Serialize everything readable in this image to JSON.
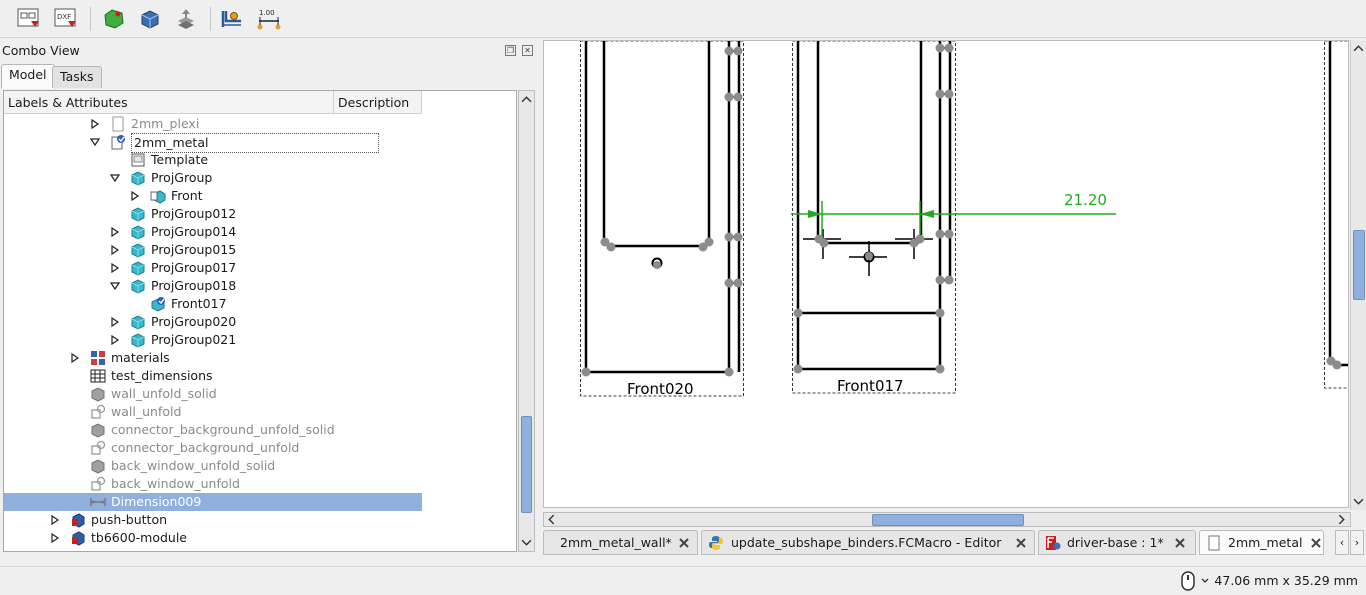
{
  "toolbar": {
    "buttons": [
      {
        "name": "export-page-svg",
        "icon": "export-svg-icon"
      },
      {
        "name": "export-page-dxf",
        "icon": "export-dxf-icon",
        "text": "DXF"
      },
      {
        "name": "draft-view",
        "icon": "draft-view-icon"
      },
      {
        "name": "arch-view",
        "icon": "arch-section-icon"
      },
      {
        "name": "spreadsheet-view",
        "icon": "spreadsheet-view-icon"
      },
      {
        "name": "insert-dimension",
        "icon": "dimension-icon"
      },
      {
        "name": "linear-dimension",
        "icon": "linear-dimension-icon",
        "text": "1.00"
      }
    ]
  },
  "combo": {
    "title": "Combo View",
    "tabs": [
      {
        "label": "Model",
        "active": true
      },
      {
        "label": "Tasks",
        "active": false
      }
    ]
  },
  "tree": {
    "columns": [
      "Labels & Attributes",
      "Description"
    ],
    "rows": [
      {
        "label": "2mm_plexi",
        "indent": 2,
        "expander": "collapsed",
        "icon": "page-icon",
        "muted": true
      },
      {
        "label": "2mm_metal",
        "indent": 2,
        "expander": "expanded",
        "icon": "page-check-icon",
        "editing": true
      },
      {
        "label": "Template",
        "indent": 3,
        "expander": "none",
        "icon": "template-icon"
      },
      {
        "label": "ProjGroup",
        "indent": 3,
        "expander": "expanded",
        "icon": "cube-icon"
      },
      {
        "label": "Front",
        "indent": 4,
        "expander": "collapsed",
        "icon": "projection-icon"
      },
      {
        "label": "ProjGroup012",
        "indent": 3,
        "expander": "none",
        "icon": "cube-icon"
      },
      {
        "label": "ProjGroup014",
        "indent": 3,
        "expander": "collapsed",
        "icon": "cube-icon"
      },
      {
        "label": "ProjGroup015",
        "indent": 3,
        "expander": "collapsed",
        "icon": "cube-icon"
      },
      {
        "label": "ProjGroup017",
        "indent": 3,
        "expander": "collapsed",
        "icon": "cube-icon"
      },
      {
        "label": "ProjGroup018",
        "indent": 3,
        "expander": "expanded",
        "icon": "cube-icon"
      },
      {
        "label": "Front017",
        "indent": 4,
        "expander": "none",
        "icon": "projection-check-icon"
      },
      {
        "label": "ProjGroup020",
        "indent": 3,
        "expander": "collapsed",
        "icon": "cube-icon"
      },
      {
        "label": "ProjGroup021",
        "indent": 3,
        "expander": "collapsed",
        "icon": "cube-icon"
      },
      {
        "label": "materials",
        "indent": 1,
        "expander": "collapsed",
        "icon": "materials-icon"
      },
      {
        "label": "test_dimensions",
        "indent": 1,
        "expander": "none",
        "icon": "spreadsheet-icon"
      },
      {
        "label": "wall_unfold_solid",
        "indent": 1,
        "expander": "none",
        "icon": "solid-icon",
        "muted": true
      },
      {
        "label": "wall_unfold",
        "indent": 1,
        "expander": "none",
        "icon": "unfold-icon",
        "muted": true
      },
      {
        "label": "connector_background_unfold_solid",
        "indent": 1,
        "expander": "none",
        "icon": "solid-icon",
        "muted": true
      },
      {
        "label": "connector_background_unfold",
        "indent": 1,
        "expander": "none",
        "icon": "unfold-icon",
        "muted": true
      },
      {
        "label": "back_window_unfold_solid",
        "indent": 1,
        "expander": "none",
        "icon": "solid-icon",
        "muted": true
      },
      {
        "label": "back_window_unfold",
        "indent": 1,
        "expander": "none",
        "icon": "unfold-icon",
        "muted": true
      },
      {
        "label": "Dimension009",
        "indent": 1,
        "expander": "none",
        "icon": "dimension-icon",
        "selected": true
      },
      {
        "label": "push-button",
        "indent": 0,
        "expander": "collapsed",
        "icon": "part-icon"
      },
      {
        "label": "tb6600-module",
        "indent": 0,
        "expander": "collapsed",
        "icon": "part-icon"
      }
    ]
  },
  "drawing": {
    "views": [
      {
        "label": "Front020"
      },
      {
        "label": "Front017"
      }
    ],
    "dimension_text": "21.20",
    "dimension_color": "#22aa22",
    "vertex_color": "#8c8c8c"
  },
  "doc_tabs": [
    {
      "label": "2mm_metal_wall*",
      "icon": "none"
    },
    {
      "label": "update_subshape_binders.FCMacro - Editor",
      "icon": "python-icon"
    },
    {
      "label": "driver-base : 1*",
      "icon": "freecad-icon"
    },
    {
      "label": "2mm_metal",
      "icon": "page-icon",
      "active": true
    }
  ],
  "status": {
    "nav_icon": "mouse-icon",
    "dimensions": "47.06 mm x 35.29 mm"
  }
}
